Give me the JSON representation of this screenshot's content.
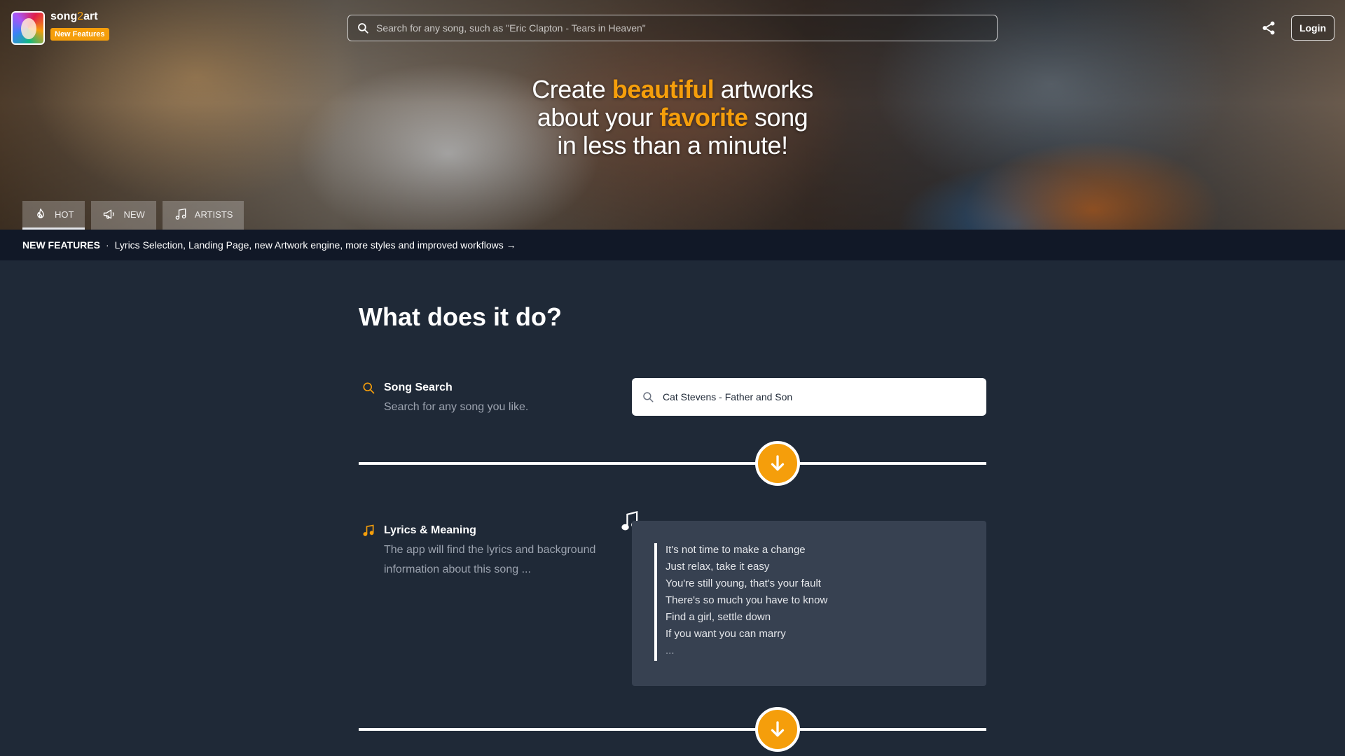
{
  "brand": {
    "name_a": "song",
    "name_b": "2",
    "name_c": "art",
    "badge": "New Features"
  },
  "search": {
    "placeholder": "Search for any song, such as \"Eric Clapton - Tears in Heaven\""
  },
  "header": {
    "login_label": "Login"
  },
  "hero": {
    "line1_pre": "Create ",
    "line1_em": "beautiful",
    "line1_post": " artworks",
    "line2_pre": "about your ",
    "line2_em": "favorite",
    "line2_post": " song",
    "line3": "in less than a minute!"
  },
  "tabs": [
    {
      "label": "HOT",
      "icon": "fire-icon"
    },
    {
      "label": "NEW",
      "icon": "megaphone-icon"
    },
    {
      "label": "ARTISTS",
      "icon": "music-note-icon"
    }
  ],
  "newsbar": {
    "label": "NEW FEATURES",
    "separator": "·",
    "text": "Lyrics Selection, Landing Page, new Artwork engine, more styles and improved workflows →"
  },
  "main": {
    "title": "What does it do?",
    "features": [
      {
        "title": "Song Search",
        "description": "Search for any song you like.",
        "icon": "search-icon"
      },
      {
        "title": "Lyrics & Meaning",
        "description": "The app will find the lyrics and background information about this song ...",
        "icon": "music-note-icon"
      }
    ],
    "demo_search_value": "Cat Stevens - Father and Son",
    "lyrics": [
      "It's not time to make a change",
      "Just relax, take it easy",
      "You're still young, that's your fault",
      "There's so much you have to know",
      "Find a girl, settle down",
      "If you want you can marry",
      "..."
    ]
  },
  "colors": {
    "accent": "#f59e0b",
    "background": "#1f2937",
    "newsbar": "#111827",
    "card": "#374151"
  }
}
